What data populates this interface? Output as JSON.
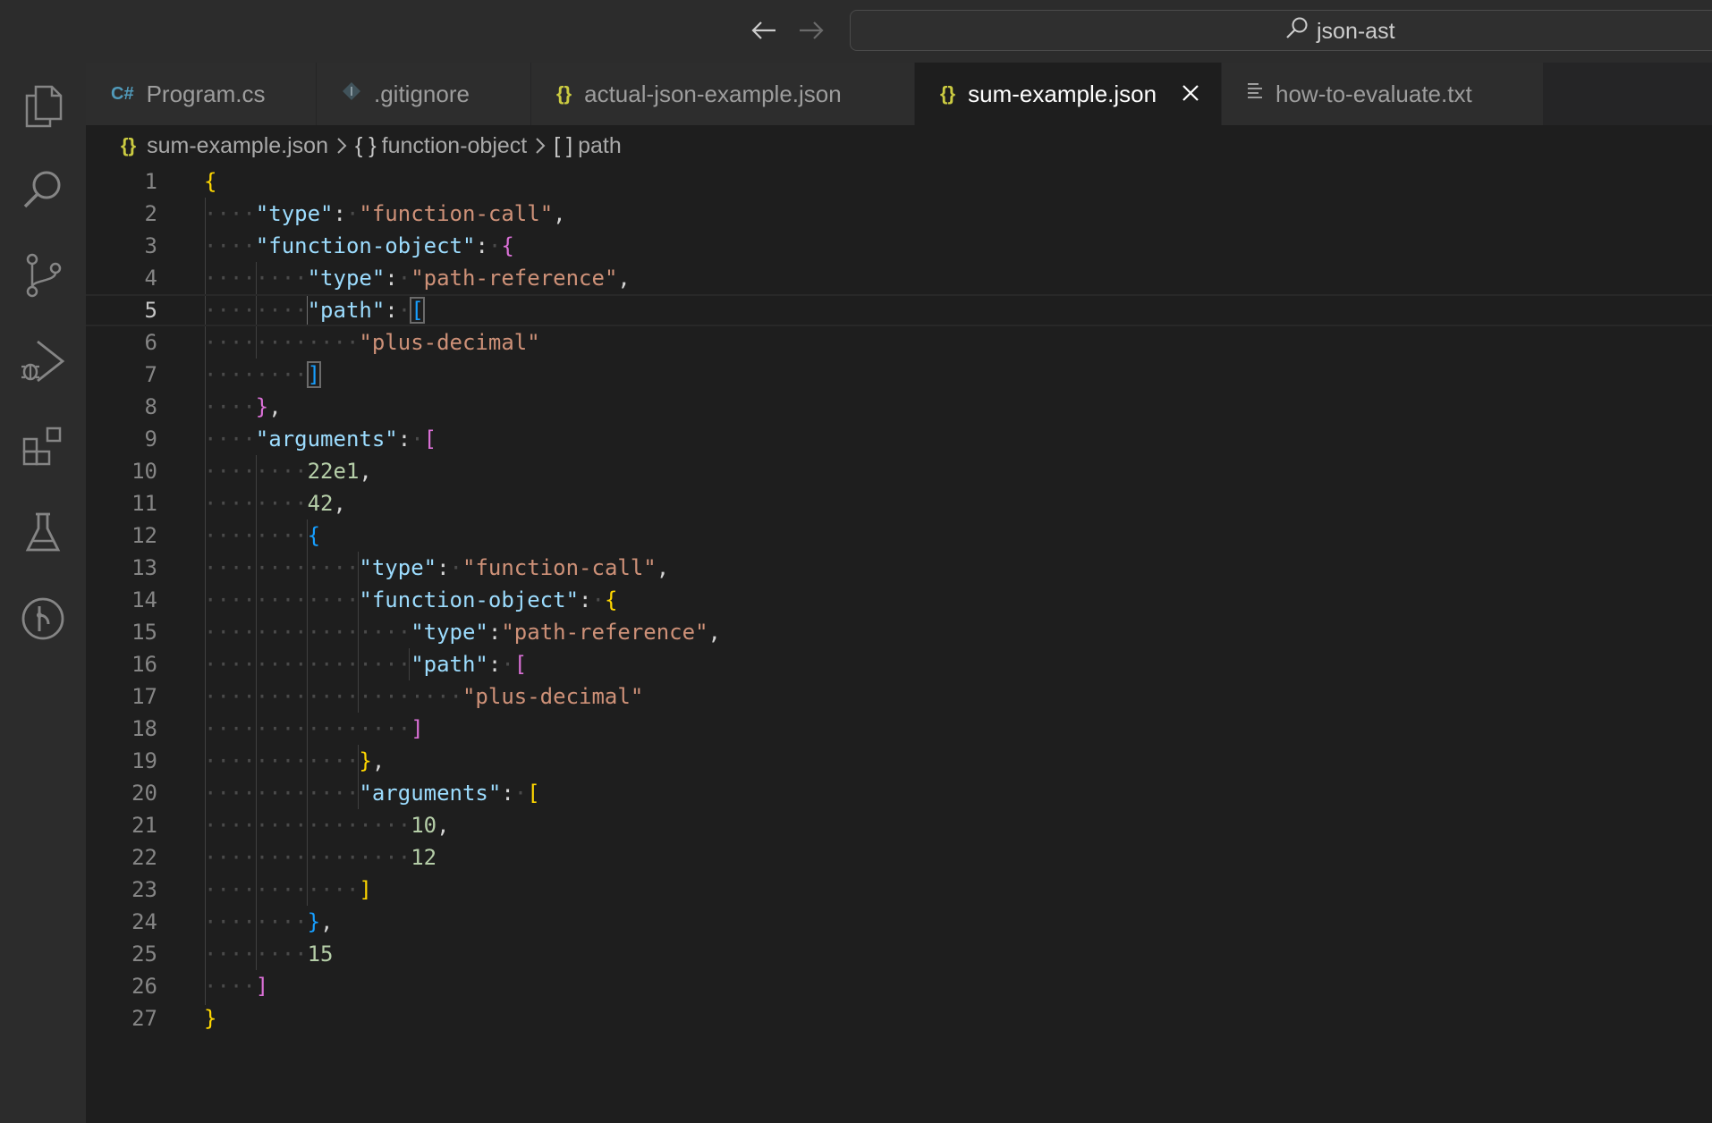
{
  "search": {
    "text": "json-ast"
  },
  "tabs": [
    {
      "label": "Program.cs",
      "icon": "C#",
      "active": false
    },
    {
      "label": ".gitignore",
      "icon": "git-diamond",
      "active": false
    },
    {
      "label": "actual-json-example.json",
      "icon": "{}",
      "active": false
    },
    {
      "label": "sum-example.json",
      "icon": "{}",
      "active": true
    },
    {
      "label": "how-to-evaluate.txt",
      "icon": "lines",
      "active": false
    }
  ],
  "breadcrumb": {
    "file": "sum-example.json",
    "object_glyph": "{ }",
    "object": "function-object",
    "array_glyph": "[ ]",
    "array": "path"
  },
  "editor": {
    "current_line": 5,
    "line_numbers": [
      "1",
      "2",
      "3",
      "4",
      "5",
      "6",
      "7",
      "8",
      "9",
      "10",
      "11",
      "12",
      "13",
      "14",
      "15",
      "16",
      "17",
      "18",
      "19",
      "20",
      "21",
      "22",
      "23",
      "24",
      "25",
      "26",
      "27"
    ]
  },
  "colors": {
    "key": "#9cdcfe",
    "string": "#ce9178",
    "number": "#b5cea8",
    "bracket_yellow": "#ffd700",
    "bracket_pink": "#da70d6",
    "bracket_blue": "#179fff"
  },
  "activity_icons": [
    "explorer-icon",
    "search-icon",
    "source-control-icon",
    "run-debug-icon",
    "extensions-icon",
    "testing-icon",
    "git-graph-icon"
  ]
}
